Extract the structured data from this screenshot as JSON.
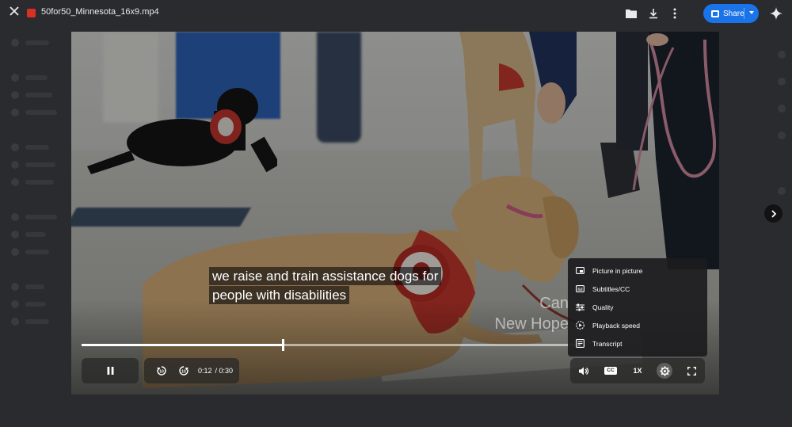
{
  "topbar": {
    "file_name": "50for50_Minnesota_16x9.mp4",
    "share_label": "Share",
    "icons": [
      "close-icon",
      "folder-icon",
      "download-icon",
      "more-vert-icon",
      "sparkle-icon"
    ]
  },
  "video": {
    "caption_lines": [
      "we raise and train assistance dogs for",
      "people with disabilities"
    ],
    "watermark_lines": [
      "Can",
      "New Hope"
    ],
    "progress_fraction": 0.4
  },
  "controls": {
    "current_time": "0:12",
    "duration": "/ 0:30",
    "speed_label": "1X",
    "cc_label": "CC"
  },
  "settings_menu": {
    "items": [
      {
        "label": "Picture in picture",
        "icon": "picture-in-picture-icon"
      },
      {
        "label": "Subtitles/CC",
        "icon": "subtitles-icon"
      },
      {
        "label": "Quality",
        "icon": "quality-sliders-icon"
      },
      {
        "label": "Playback speed",
        "icon": "playback-speed-icon"
      },
      {
        "label": "Transcript",
        "icon": "transcript-icon"
      }
    ]
  },
  "colors": {
    "accent": "#1a73e8",
    "file_icon": "#d93025",
    "overlay": "#202124"
  }
}
